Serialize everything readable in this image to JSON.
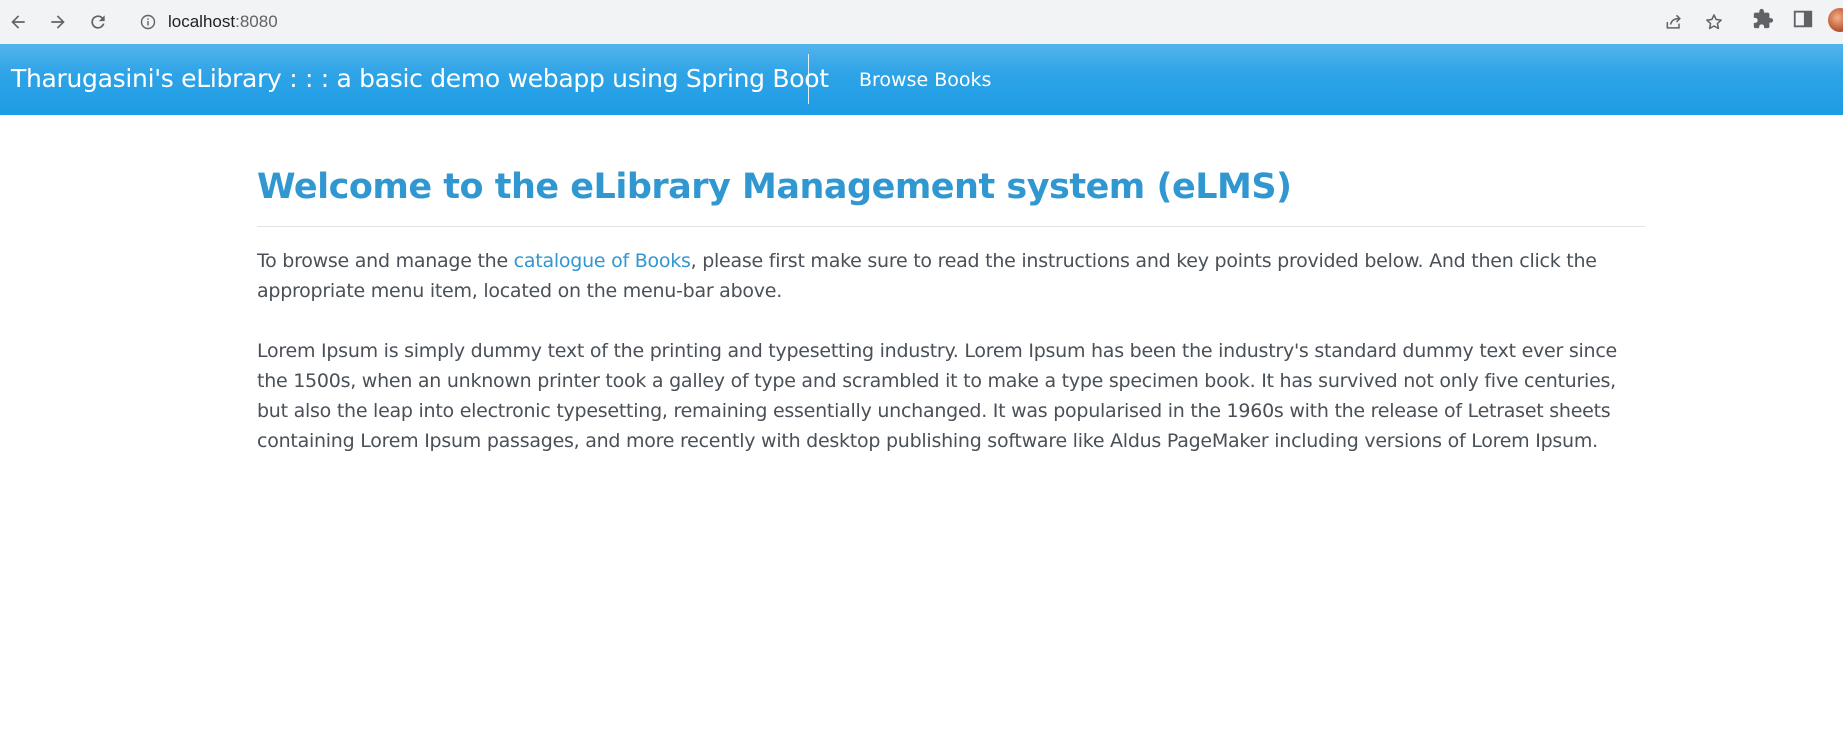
{
  "browser": {
    "url_host": "localhost",
    "url_port": ":8080",
    "back_icon": "arrow-left-icon",
    "forward_icon": "arrow-right-icon",
    "reload_icon": "reload-icon",
    "info_icon": "info-icon",
    "share_icon": "share-icon",
    "bookmark_icon": "star-icon",
    "extensions_icon": "puzzle-icon",
    "sidepanel_icon": "side-panel-icon"
  },
  "navbar": {
    "brand": "Tharugasini's eLibrary : : : a basic demo webapp using Spring Boot",
    "links": [
      "Browse Books"
    ],
    "color": "#2fa4e7"
  },
  "main": {
    "title": "Welcome to the eLibrary Management system (eLMS)",
    "intro_before": "To browse and manage the ",
    "intro_link": "catalogue of Books",
    "intro_after": ", please first make sure to read the instructions and key points provided below. And then click the appropriate menu item, located on the menu-bar above.",
    "lorem": "Lorem Ipsum is simply dummy text of the printing and typesetting industry. Lorem Ipsum has been the industry's standard dummy text ever since the 1500s, when an unknown printer took a galley of type and scrambled it to make a type specimen book. It has survived not only five centuries, but also the leap into electronic typesetting, remaining essentially unchanged. It was popularised in the 1960s with the release of Letraset sheets containing Lorem Ipsum passages, and more recently with desktop publishing software like Aldus PageMaker including versions of Lorem Ipsum.",
    "accent_color": "#3097d1"
  }
}
